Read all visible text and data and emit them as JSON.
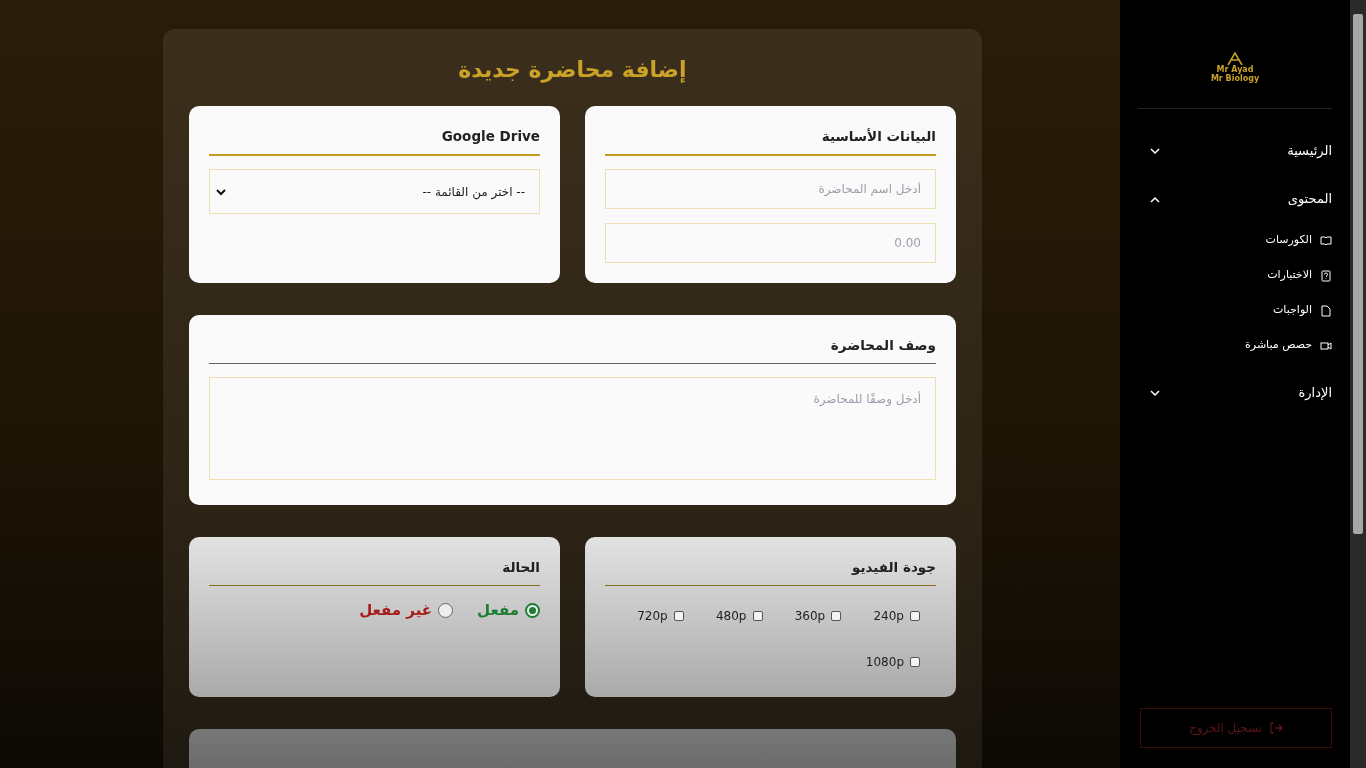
{
  "page_title": "إضافة محاضرة جديدة",
  "basic_card": {
    "title": "البيانات الأساسية",
    "fields": [
      {
        "placeholder": "أدخل اسم المحاضرة"
      },
      {
        "placeholder": "0.00"
      }
    ]
  },
  "drive_card": {
    "title": "Google Drive",
    "select": {
      "value": "-- اختر من القائمة --"
    }
  },
  "description_card": {
    "title": "وصف المحاضرة",
    "textarea": {
      "placeholder": "أدخل وصفًا للمحاضرة"
    }
  },
  "quality_card": {
    "title": "جودة الفيديو",
    "options": [
      {
        "label": "240p",
        "checked": false
      },
      {
        "label": "360p",
        "checked": false
      },
      {
        "label": "480p",
        "checked": false
      },
      {
        "label": "720p",
        "checked": false
      },
      {
        "label": "1080p",
        "checked": false
      }
    ]
  },
  "status_card": {
    "title": "الحالة",
    "options": [
      {
        "label": "مفعل",
        "selected": true,
        "color": "#1e7e34"
      },
      {
        "label": "غير مفعل",
        "selected": false,
        "color": "#a61b1b"
      }
    ]
  },
  "sidebar": {
    "logo": {
      "line_1": "Mr Ayad",
      "line_2": "Mr Biology"
    },
    "items": [
      {
        "label": "الرئيسية",
        "expanded": false
      },
      {
        "label": "المحتوى",
        "expanded": true,
        "children": [
          {
            "label": "الكورسات",
            "kind": "book"
          },
          {
            "label": "الاختبارات",
            "kind": "quiz"
          },
          {
            "label": "الواجبات",
            "kind": "file"
          },
          {
            "label": "حصص مباشرة",
            "kind": "video"
          }
        ]
      },
      {
        "label": "الإدارة",
        "expanded": false
      }
    ],
    "logout": "تسجيل الخروج"
  }
}
